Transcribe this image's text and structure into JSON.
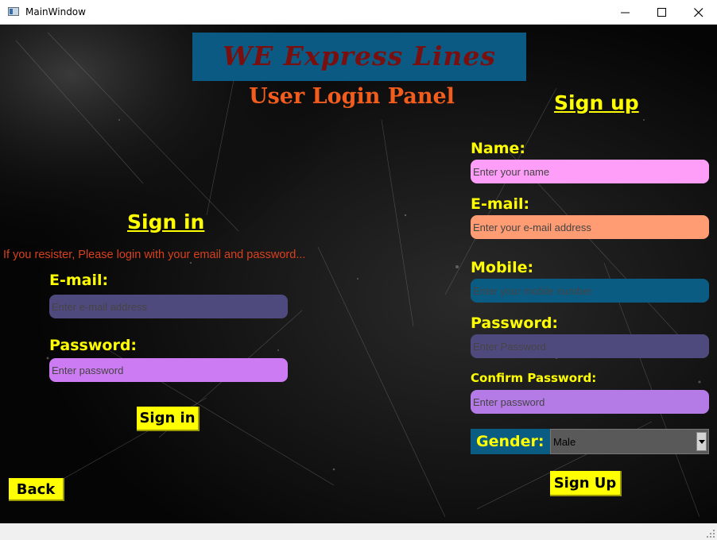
{
  "window": {
    "title": "MainWindow"
  },
  "header": {
    "logo": "WE Express Lines",
    "panel_title": "User Login Panel"
  },
  "signin": {
    "title": "Sign in ",
    "info": "If you resister, Please login with your email and password...",
    "email_label": "E-mail:",
    "email_placeholder": "Enter e-mail address",
    "password_label": "Password:",
    "password_placeholder": "Enter password",
    "button": "Sign in"
  },
  "signup": {
    "title": "Sign up ",
    "name_label": "Name:",
    "name_placeholder": "Enter your name",
    "email_label": "E-mail:",
    "email_placeholder": "Enter your e-mail address",
    "mobile_label": "Mobile:",
    "mobile_placeholder": "Enter your mobile number",
    "password_label": "Password:",
    "password_placeholder": "Enter Password",
    "confirm_label": "Confirm Password:",
    "confirm_placeholder": "Enter password",
    "gender_label": "Gender:",
    "gender_value": "Male",
    "button": "Sign Up"
  },
  "back_button": "Back",
  "colors": {
    "accent_yellow": "#ffff00",
    "title_orange": "#f25d1e",
    "logo_bg": "#0a5a84",
    "logo_text": "#7a0f0f"
  }
}
